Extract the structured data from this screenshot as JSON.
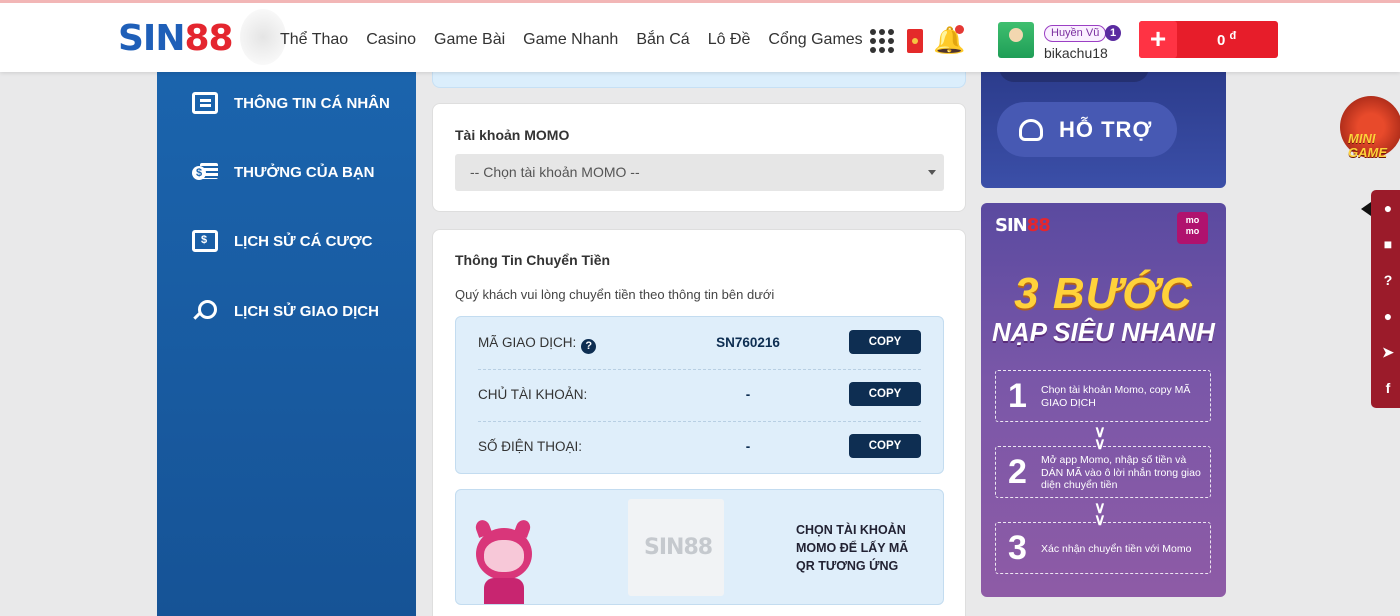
{
  "header": {
    "logo_part1": "SIN",
    "logo_part2": "88",
    "nav": [
      "Thể Thao",
      "Casino",
      "Game Bài",
      "Game Nhanh",
      "Bắn Cá",
      "Lô Đề",
      "Cổng Games"
    ],
    "user": {
      "rank_label": "Huyền Vũ",
      "rank_level": "1",
      "username": "bikachu18"
    },
    "deposit": {
      "plus": "+",
      "amount": "0",
      "currency": "đ"
    }
  },
  "sidebar": {
    "items": [
      {
        "label": "THÔNG TIN CÁ NHÂN",
        "icon": "profile-card-icon"
      },
      {
        "label": "THƯỞNG CỦA BẠN",
        "icon": "coins-icon"
      },
      {
        "label": "LỊCH SỬ CÁ CƯỢC",
        "icon": "bill-icon"
      },
      {
        "label": "LỊCH SỬ GIAO DỊCH",
        "icon": "search-history-icon"
      }
    ]
  },
  "momo_account": {
    "title": "Tài khoản MOMO",
    "select_value": "-- Chọn tài khoản MOMO --"
  },
  "transfer": {
    "title": "Thông Tin Chuyển Tiền",
    "subtitle": "Quý khách vui lòng chuyển tiền theo thông tin bên dưới",
    "rows": [
      {
        "label": "MÃ GIAO DỊCH:",
        "value": "SN760216",
        "button": "COPY",
        "has_help": true
      },
      {
        "label": "CHỦ TÀI KHOẢN:",
        "value": "-",
        "button": "COPY",
        "has_help": false
      },
      {
        "label": "SỐ ĐIỆN THOẠI:",
        "value": "-",
        "button": "COPY",
        "has_help": false
      }
    ],
    "help_icon": "?",
    "qr_logo": "SIN88",
    "qr_note": "CHỌN TÀI KHOẢN MOMO ĐỂ LẤY MÃ QR TƯƠNG ỨNG"
  },
  "support": {
    "label": "HỖ TRỢ"
  },
  "promo": {
    "logo_part1": "SIN",
    "logo_part2": "88",
    "momo_badge_line1": "mo",
    "momo_badge_line2": "mo",
    "headline": "3 BƯỚC",
    "subheadline": "NẠP SIÊU NHANH",
    "steps": [
      {
        "num": "1",
        "text": "Chọn tài khoản Momo, copy MÃ GIAO DỊCH"
      },
      {
        "num": "2",
        "text": "Mở app Momo, nhập số tiền và DÁN MÃ vào ô lời nhắn trong giao diện chuyển tiền"
      },
      {
        "num": "3",
        "text": "Xác nhận chuyển tiền với Momo"
      }
    ]
  },
  "floating": {
    "minigame_line1": "MINI",
    "minigame_line2": "GAME"
  },
  "colors": {
    "brand_blue": "#1b64ad",
    "brand_red": "#e71d2a",
    "copy_button": "#0e2e52",
    "info_box": "#dfeefa"
  }
}
